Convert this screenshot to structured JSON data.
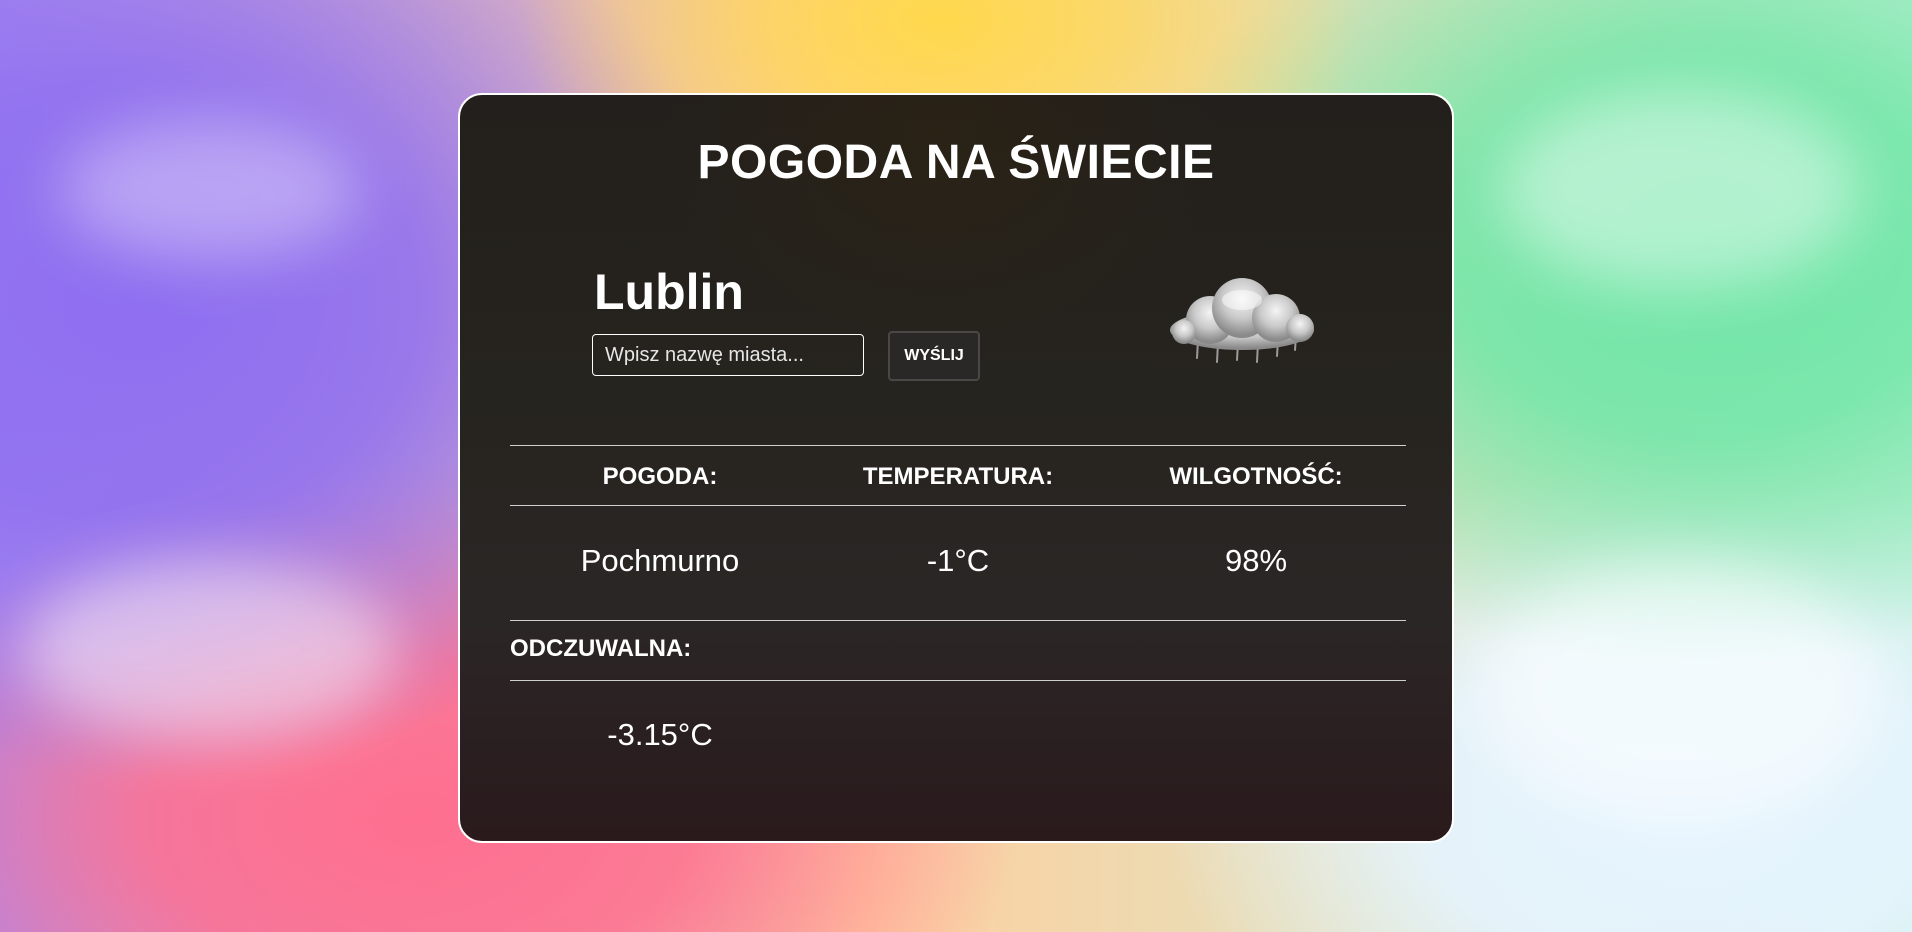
{
  "page": {
    "title": "POGODA NA ŚWIECIE"
  },
  "location": {
    "city": "Lublin"
  },
  "search": {
    "placeholder": "Wpisz nazwę miasta...",
    "button_label": "WYŚLIJ"
  },
  "weather_icon": "cloud-rain-icon",
  "table": {
    "headers": [
      "POGODA:",
      "TEMPERATURA:",
      "WILGOTNOŚĆ:"
    ],
    "values": [
      "Pochmurno",
      "-1°C",
      "98%"
    ]
  },
  "feels_like": {
    "label": "ODCZUWALNA:",
    "value": "-3.15°C"
  },
  "colors": {
    "card_bg": "#26241e",
    "card_border": "#ffffff",
    "text": "#ffffff"
  }
}
